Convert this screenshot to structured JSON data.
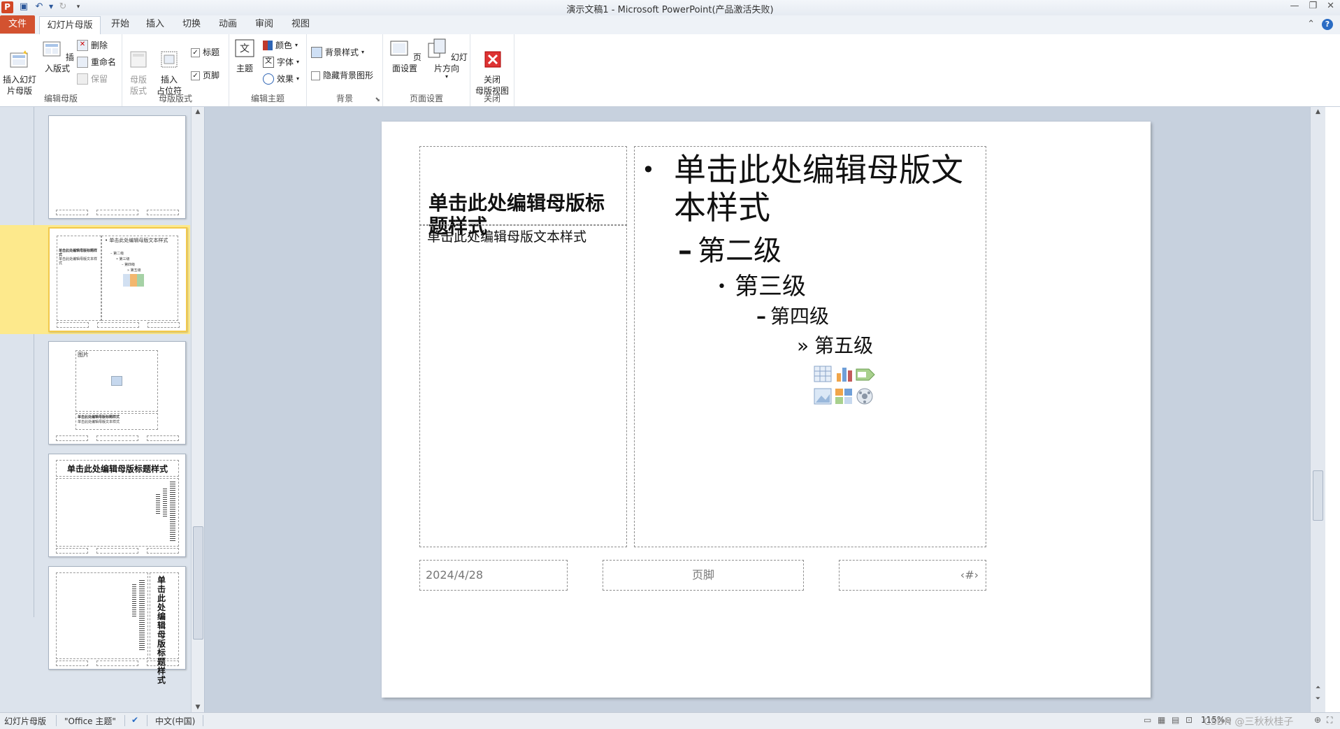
{
  "window": {
    "title": "演示文稿1 - Microsoft PowerPoint(产品激活失败)",
    "app_icon": "P",
    "controls": [
      "—",
      "❐",
      "✕"
    ]
  },
  "tabs": [
    {
      "label": "文件"
    },
    {
      "label": "幻灯片母版"
    },
    {
      "label": "开始"
    },
    {
      "label": "插入"
    },
    {
      "label": "切换"
    },
    {
      "label": "动画"
    },
    {
      "label": "审阅"
    },
    {
      "label": "视图"
    }
  ],
  "ribbon": {
    "edit_master": {
      "label": "编辑母版",
      "insert_master": "插入幻灯\n片母版",
      "insert_layout": "插入版式",
      "delete": "删除",
      "rename": "重命名",
      "preserve": "保留"
    },
    "master_layout": {
      "label": "母版版式",
      "master_layout_btn": "母版\n版式",
      "insert_placeholder": "插入\n占位符",
      "title_chk": "标题",
      "footer_chk": "页脚"
    },
    "edit_theme": {
      "label": "编辑主题",
      "themes": "主题",
      "colors": "颜色",
      "fonts": "字体",
      "effects": "效果"
    },
    "background": {
      "label": "背景",
      "bg_styles": "背景样式",
      "hide_bg": "隐藏背景图形"
    },
    "page_setup": {
      "label": "页面设置",
      "page_setup_btn": "页面设置",
      "orientation": "幻灯片方向"
    },
    "close": {
      "label": "关闭",
      "close_btn": "关闭\n母版视图"
    }
  },
  "thumbnails": {
    "t3_label": "图片",
    "t4_title": "单击此处编辑母版标题样式",
    "t5_vertical": "单击此处编辑母版标题样式"
  },
  "slide": {
    "title_placeholder": "单击此处编辑母版标题样式",
    "left_body": "单击此处编辑母版文本样式",
    "levels": [
      {
        "bullet": "•",
        "text": "单击此处编辑母版文本样式"
      },
      {
        "bullet": "–",
        "text": "第二级"
      },
      {
        "bullet": "•",
        "text": "第三级"
      },
      {
        "bullet": "–",
        "text": "第四级"
      },
      {
        "bullet": "»",
        "text": "第五级"
      }
    ],
    "footer": {
      "date": "2024/4/28",
      "center": "页脚",
      "number": "‹#›"
    }
  },
  "statusbar": {
    "view": "幻灯片母版",
    "theme": "\"Office 主题\"",
    "language": "中文(中国)",
    "zoom": "115%",
    "watermark": "CSDN @三秋秋桂子"
  }
}
